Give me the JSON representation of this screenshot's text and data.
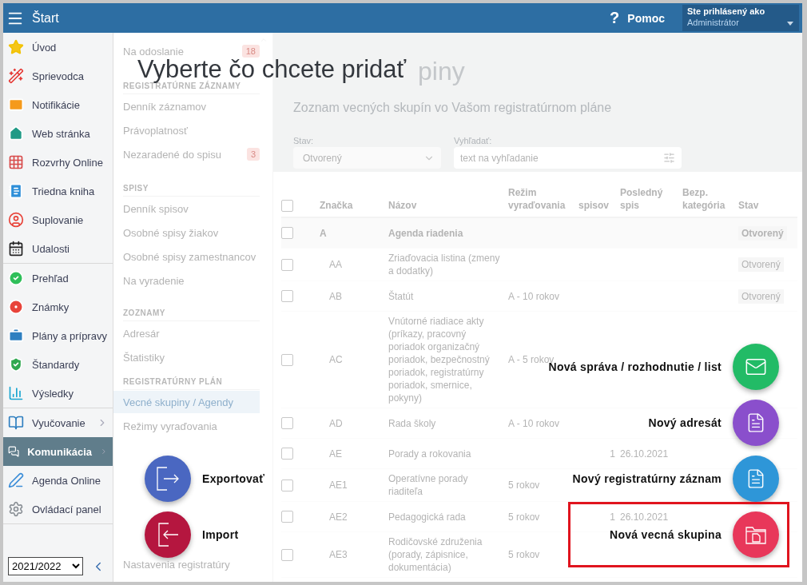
{
  "topbar": {
    "title": "Štart",
    "help_mark": "?",
    "help_label": "Pomoc",
    "user_caption": "Ste prihlásený ako",
    "user_name": "Administrátor"
  },
  "sidebar": {
    "groups": [
      [
        {
          "label": "Úvod",
          "selected": false
        },
        {
          "label": "Sprievodca",
          "selected": false
        },
        {
          "label": "Notifikácie",
          "selected": false
        },
        {
          "label": "Web stránka",
          "selected": false
        },
        {
          "label": "Rozvrhy Online",
          "selected": false
        },
        {
          "label": "Triedna kniha",
          "selected": false
        },
        {
          "label": "Suplovanie",
          "selected": false
        },
        {
          "label": "Udalosti",
          "selected": false
        }
      ],
      [
        {
          "label": "Prehľad",
          "selected": false
        },
        {
          "label": "Známky",
          "selected": false
        },
        {
          "label": "Plány a prípravy",
          "selected": false
        },
        {
          "label": "Štandardy",
          "selected": false
        },
        {
          "label": "Výsledky",
          "selected": false
        }
      ],
      [
        {
          "label": "Vyučovanie",
          "selected": false,
          "submenu": true
        },
        {
          "label": "Komunikácia",
          "selected": true,
          "submenu": true
        },
        {
          "label": "Agenda Online",
          "selected": false,
          "submenu": false
        },
        {
          "label": "Ovládací panel",
          "selected": false,
          "submenu": false
        }
      ]
    ],
    "year": "2021/2022"
  },
  "submenu": {
    "top": {
      "label": "Na odoslanie",
      "badge": "18"
    },
    "sections": [
      {
        "title": "REGISTRATÚRNE ZÁZNAMY",
        "items": [
          {
            "label": "Denník záznamov",
            "selected": false
          },
          {
            "label": "Právoplatnosť",
            "selected": false
          },
          {
            "label": "Nezaradené do spisu",
            "badge": "3",
            "selected": false
          }
        ]
      },
      {
        "title": "SPISY",
        "items": [
          {
            "label": "Denník spisov",
            "selected": false
          },
          {
            "label": "Osobné spisy žiakov",
            "selected": false
          },
          {
            "label": "Osobné spisy zamestnancov",
            "selected": false
          },
          {
            "label": "Na vyradenie",
            "selected": false
          }
        ]
      },
      {
        "title": "ZOZNAMY",
        "items": [
          {
            "label": "Adresár",
            "selected": false
          },
          {
            "label": "Štatistiky",
            "selected": false
          }
        ]
      },
      {
        "title": "REGISTRATÚRNY PLÁN",
        "items": [
          {
            "label": "Vecné skupiny / Agendy",
            "selected": true
          },
          {
            "label": "Režimy vyraďovania",
            "selected": false
          }
        ]
      }
    ],
    "bottom_item": "Nastavenia registratúry"
  },
  "page": {
    "title": "piny",
    "subtitle": "Zoznam vecných skupín vo Vašom registratúrnom pláne",
    "filters": {
      "state_label": "Stav:",
      "state_value": "Otvorený",
      "search_label": "Vyhľadať:",
      "search_placeholder": "text na vyhľadanie"
    }
  },
  "table": {
    "all_checked": false,
    "columns": [
      "Značka",
      "Názov",
      "Režim vyraďovania",
      "spisov",
      "Posledný spis",
      "Bezp. kategória",
      "Stav"
    ],
    "rows": [
      {
        "code": "A",
        "name": "Agenda riadenia",
        "mode": "",
        "count": "",
        "last": "",
        "state": "Otvorený",
        "group": true,
        "checked": false
      },
      {
        "code": "AA",
        "name": "Zriaďovacia listina (zmeny a dodatky)",
        "mode": "",
        "count": "",
        "last": "",
        "state": "Otvorený",
        "group": false,
        "checked": false
      },
      {
        "code": "AB",
        "name": "Štatút",
        "mode": "A - 10 rokov",
        "count": "",
        "last": "",
        "state": "Otvorený",
        "group": false,
        "checked": false
      },
      {
        "code": "AC",
        "name": "Vnútorné riadiace akty (príkazy, pracovný poriadok organizačný poriadok, bezpečnostný poriadok, registratúrny poriadok, smernice, pokyny)",
        "mode": "A - 5 rokov",
        "count": "",
        "last": "",
        "state": "",
        "group": false,
        "checked": false
      },
      {
        "code": "AD",
        "name": "Rada školy",
        "mode": "A - 10 rokov",
        "count": "",
        "last": "",
        "state": "",
        "group": false,
        "checked": false
      },
      {
        "code": "AE",
        "name": "Porady a rokovania",
        "mode": "",
        "count": "1",
        "last": "26.10.2021",
        "state": "",
        "group": false,
        "checked": false
      },
      {
        "code": "AE1",
        "name": "Operatívne porady riaditeľa",
        "mode": "5 rokov",
        "count": "",
        "last": "",
        "state": "",
        "group": false,
        "checked": false
      },
      {
        "code": "AE2",
        "name": "Pedagogická rada",
        "mode": "5 rokov",
        "count": "1",
        "last": "26.10.2021",
        "state": "",
        "group": false,
        "checked": false
      },
      {
        "code": "AE3",
        "name": "Rodičovské združenia (porady, zápisnice, dokumentácia)",
        "mode": "5 rokov",
        "count": "",
        "last": "",
        "state": "",
        "group": false,
        "checked": false
      }
    ]
  },
  "picker": {
    "title": "Vyberte čo chcete pridať",
    "actions": [
      {
        "label": "Nová správa / rozhodnutie / list",
        "color": "#22bb66",
        "highlighted": false
      },
      {
        "label": "Nový adresát",
        "color": "#8a4fcc",
        "highlighted": false
      },
      {
        "label": "Nový registratúrny záznam",
        "color": "#2e96d8",
        "highlighted": false
      },
      {
        "label": "Nová vecná skupina",
        "color": "#e8375a",
        "highlighted": true
      }
    ],
    "side_actions": [
      {
        "label": "Exportovať",
        "color": "#4a67c1"
      },
      {
        "label": "Import",
        "color": "#b5163f"
      }
    ]
  }
}
